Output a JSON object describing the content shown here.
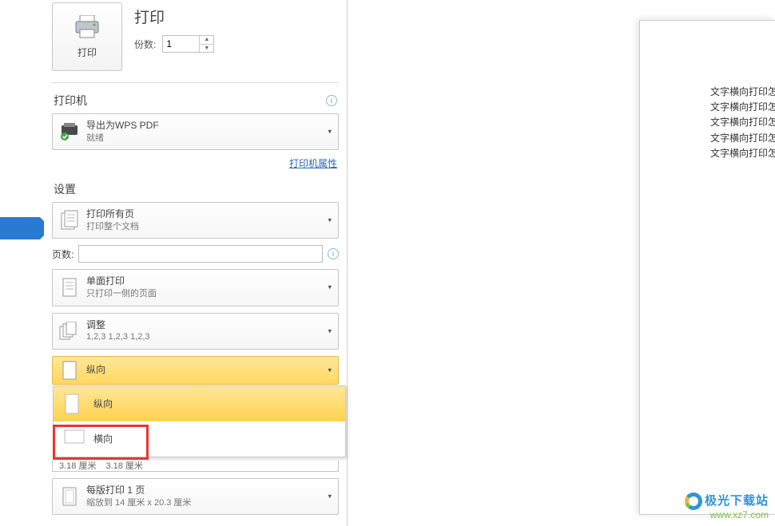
{
  "header": {
    "print_title": "打印",
    "print_btn_label": "打印",
    "copies_label": "份数:",
    "copies_value": "1"
  },
  "printer_section": {
    "title": "打印机",
    "selected": "导出为WPS PDF",
    "status": "就绪",
    "properties_link": "打印机属性"
  },
  "settings_section": {
    "title": "设置",
    "print_all": {
      "label": "打印所有页",
      "sub": "打印整个文档"
    },
    "pages_label": "页数:",
    "pages_value": "",
    "duplex": {
      "label": "单面打印",
      "sub": "只打印一侧的页面"
    },
    "collate": {
      "label": "调整",
      "sub": "1,2,3    1,2,3    1,2,3"
    },
    "orientation_current": "纵向",
    "orientation_options": {
      "portrait": "纵向",
      "landscape": "横向"
    },
    "partial_margin": "3.18 厘米",
    "per_sheet": {
      "label": "每版打印 1 页",
      "sub": "缩放到 14 厘米 x 20.3 厘米"
    }
  },
  "preview": {
    "lines": [
      "文字横向打印怎",
      "文字横向打印怎",
      "文字横向打印怎",
      "",
      "文字横向打印怎",
      "",
      "文字横向打印怎"
    ]
  },
  "watermark": {
    "name": "极光下载站",
    "url": "www.xz7.com"
  }
}
